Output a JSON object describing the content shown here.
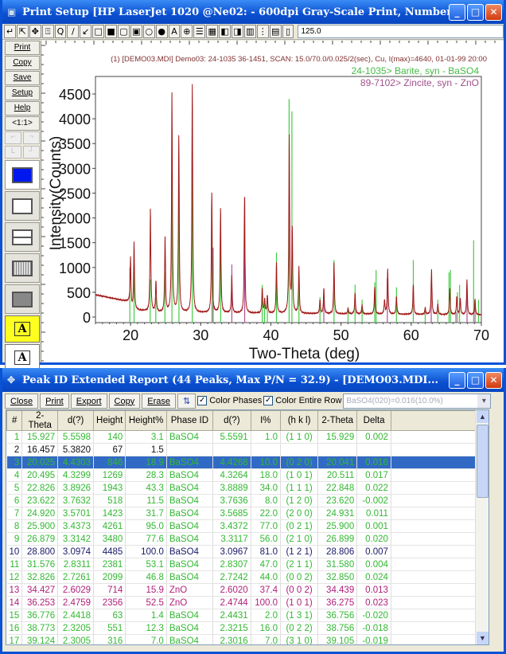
{
  "print_window": {
    "title": "Print Setup [HP LaserJet 1020 @Ne02: - 600dpi Gray-Scale Print, Number of Har...",
    "toolbar_icons": [
      "return-icon",
      "pointer-icon",
      "move-icon",
      "text-cursor-icon",
      "magnifier-icon",
      "line-icon",
      "arrow-line-icon",
      "rectangle-icon",
      "filled-rectangle-icon",
      "rounded-rect-icon",
      "filled-rounded-rect-icon",
      "ellipse-icon",
      "filled-ellipse-icon",
      "text-A-icon",
      "circled-number-icon",
      "list-icon",
      "grid-icon",
      "bw-icon",
      "gray-icon",
      "color-icon",
      "dots-icon",
      "layout-icon",
      "trash-icon"
    ],
    "toolbar_glyphs": [
      "↵",
      "⇱",
      "✥",
      "⍐",
      "Q",
      "/",
      "↙",
      "□",
      "■",
      "▢",
      "▣",
      "○",
      "●",
      "A",
      "⊕",
      "☰",
      "▦",
      "◧",
      "◨",
      "▥",
      "⋮",
      "▤",
      "▯"
    ],
    "zoom_value": "125.0",
    "sidebar": {
      "buttons": [
        "Print",
        "Copy",
        "Save",
        "Setup",
        "Help"
      ],
      "ratio": "<1:1>"
    },
    "header_line": "(1) [DEMO03.MDI] Demo03: 24-1035 36-1451, SCAN: 15.0/70.0/0.025/2(sec), Cu, I(max)=4640, 01-01-99 20:00"
  },
  "chart_data": {
    "type": "line",
    "xlabel": "Two-Theta (deg)",
    "ylabel": "Intensity(Counts)",
    "xlim": [
      15,
      70
    ],
    "ylim": [
      0,
      4800
    ],
    "xticks": [
      20,
      30,
      40,
      50,
      60,
      70
    ],
    "yticks": [
      0,
      500,
      1000,
      1500,
      2000,
      2500,
      3000,
      3500,
      4000,
      4500
    ],
    "grid": false,
    "legend": [
      {
        "name": "24-1035> Barite, syn - BaSO4",
        "color": "#44bb44"
      },
      {
        "name": "89-7102> Zincite, syn - ZnO",
        "color": "#a0508a"
      }
    ],
    "observed_color": "#a01818",
    "observed_peaks": [
      [
        20.0,
        1000
      ],
      [
        20.5,
        1400
      ],
      [
        22.83,
        2100
      ],
      [
        23.62,
        650
      ],
      [
        24.92,
        1550
      ],
      [
        25.9,
        4450
      ],
      [
        26.88,
        3600
      ],
      [
        28.8,
        4640
      ],
      [
        31.58,
        2450
      ],
      [
        32.83,
        2150
      ],
      [
        34.43,
        780
      ],
      [
        36.25,
        2370
      ],
      [
        38.77,
        520
      ],
      [
        39.12,
        300
      ],
      [
        39.5,
        380
      ],
      [
        40.8,
        1050
      ],
      [
        42.62,
        3600
      ],
      [
        43.05,
        1700
      ],
      [
        44.0,
        950
      ],
      [
        47.0,
        300
      ],
      [
        47.55,
        520
      ],
      [
        49.0,
        1050
      ],
      [
        51.0,
        130
      ],
      [
        52.0,
        450
      ],
      [
        53.0,
        200
      ],
      [
        54.8,
        560
      ],
      [
        56.2,
        300
      ],
      [
        56.65,
        930
      ],
      [
        57.9,
        380
      ],
      [
        60.3,
        620
      ],
      [
        62.0,
        150
      ],
      [
        62.9,
        920
      ],
      [
        63.8,
        230
      ],
      [
        65.5,
        530
      ],
      [
        66.5,
        380
      ],
      [
        67.0,
        330
      ],
      [
        67.95,
        720
      ],
      [
        69.1,
        330
      ]
    ],
    "baso4_sticks": [
      [
        19.9,
        1000
      ],
      [
        20.5,
        1350
      ],
      [
        22.8,
        760
      ],
      [
        23.6,
        400
      ],
      [
        24.9,
        900
      ],
      [
        25.9,
        3800
      ],
      [
        26.9,
        2500
      ],
      [
        28.8,
        3300
      ],
      [
        31.6,
        1800
      ],
      [
        32.85,
        1700
      ],
      [
        38.77,
        650
      ],
      [
        39.1,
        300
      ],
      [
        39.5,
        400
      ],
      [
        40.8,
        1300
      ],
      [
        42.6,
        4400
      ],
      [
        43.0,
        4150
      ],
      [
        44.0,
        850
      ],
      [
        47.0,
        400
      ],
      [
        49.0,
        1150
      ],
      [
        51.0,
        200
      ],
      [
        52.0,
        650
      ],
      [
        53.0,
        350
      ],
      [
        54.8,
        700
      ],
      [
        55.0,
        950
      ],
      [
        57.9,
        600
      ],
      [
        60.3,
        1150
      ],
      [
        62.0,
        200
      ],
      [
        63.8,
        350
      ],
      [
        65.4,
        900
      ],
      [
        65.6,
        950
      ],
      [
        66.6,
        500
      ],
      [
        66.9,
        650
      ],
      [
        68.9,
        1550
      ],
      [
        69.6,
        350
      ]
    ],
    "zno_sticks": [
      [
        31.77,
        1400
      ],
      [
        34.44,
        1060
      ],
      [
        36.27,
        2420
      ],
      [
        47.55,
        560
      ],
      [
        56.6,
        780
      ],
      [
        62.86,
        700
      ],
      [
        66.38,
        100
      ],
      [
        67.96,
        560
      ],
      [
        69.1,
        270
      ]
    ]
  },
  "report_window": {
    "title": "Peak ID Extended Report (44 Peaks, Max P/N = 32.9) - [DEMO03.MDI...",
    "buttons": [
      "Close",
      "Print",
      "Export",
      "Copy",
      "Erase"
    ],
    "color_phases_label": "Color Phases",
    "color_phases_checked": true,
    "color_row_label": "Color Entire Row",
    "color_row_checked": true,
    "combo_value": "BaSO4(020)=0.016(10.0%)",
    "columns": [
      "#",
      "2-Theta",
      "d(?)",
      "Height",
      "Height%",
      "Phase ID",
      "d(?)",
      "I%",
      "(h k l)",
      "2-Theta",
      "Delta"
    ],
    "phase_colors": {
      "BaSO4": "#33b833",
      "ZnO": "#b0207a",
      "none": "#111111",
      "strong": "#1a1a6a"
    },
    "selected_row": 3,
    "rows": [
      [
        "1",
        "15.927",
        "5.5598",
        "140",
        "3.1",
        "BaSO4",
        "5.5591",
        "1.0",
        "(1 1 0)",
        "15.929",
        "0.002"
      ],
      [
        "2",
        "16.457",
        "5.3820",
        "67",
        "1.5",
        "",
        "",
        "",
        "",
        "",
        ""
      ],
      [
        "3",
        "20.025",
        "4.4303",
        "846",
        "18.9",
        "BaSO4",
        "4.4268",
        "10.0",
        "(0 2 0)",
        "20.041",
        "0.016"
      ],
      [
        "4",
        "20.495",
        "4.3299",
        "1269",
        "28.3",
        "BaSO4",
        "4.3264",
        "18.0",
        "(1 0 1)",
        "20.511",
        "0.017"
      ],
      [
        "5",
        "22.826",
        "3.8926",
        "1943",
        "43.3",
        "BaSO4",
        "3.8889",
        "34.0",
        "(1 1 1)",
        "22.848",
        "0.022"
      ],
      [
        "6",
        "23.622",
        "3.7632",
        "518",
        "11.5",
        "BaSO4",
        "3.7636",
        "8.0",
        "(1 2 0)",
        "23.620",
        "-0.002"
      ],
      [
        "7",
        "24.920",
        "3.5701",
        "1423",
        "31.7",
        "BaSO4",
        "3.5685",
        "22.0",
        "(2 0 0)",
        "24.931",
        "0.011"
      ],
      [
        "8",
        "25.900",
        "3.4373",
        "4261",
        "95.0",
        "BaSO4",
        "3.4372",
        "77.0",
        "(0 2 1)",
        "25.900",
        "0.001"
      ],
      [
        "9",
        "26.879",
        "3.3142",
        "3480",
        "77.6",
        "BaSO4",
        "3.3117",
        "56.0",
        "(2 1 0)",
        "26.899",
        "0.020"
      ],
      [
        "10",
        "28.800",
        "3.0974",
        "4485",
        "100.0",
        "BaSO4",
        "3.0967",
        "81.0",
        "(1 2 1)",
        "28.806",
        "0.007"
      ],
      [
        "11",
        "31.576",
        "2.8311",
        "2381",
        "53.1",
        "BaSO4",
        "2.8307",
        "47.0",
        "(2 1 1)",
        "31.580",
        "0.004"
      ],
      [
        "12",
        "32.826",
        "2.7261",
        "2099",
        "46.8",
        "BaSO4",
        "2.7242",
        "44.0",
        "(0 0 2)",
        "32.850",
        "0.024"
      ],
      [
        "13",
        "34.427",
        "2.6029",
        "714",
        "15.9",
        "ZnO",
        "2.6020",
        "37.4",
        "(0 0 2)",
        "34.439",
        "0.013"
      ],
      [
        "14",
        "36.253",
        "2.4759",
        "2356",
        "52.5",
        "ZnO",
        "2.4744",
        "100.0",
        "(1 0 1)",
        "36.275",
        "0.023"
      ],
      [
        "15",
        "36.776",
        "2.4418",
        "63",
        "1.4",
        "BaSO4",
        "2.4431",
        "2.0",
        "(1 3 1)",
        "36.756",
        "-0.020"
      ],
      [
        "16",
        "38.773",
        "2.3205",
        "551",
        "12.3",
        "BaSO4",
        "2.3215",
        "16.0",
        "(0 2 2)",
        "38.756",
        "-0.018"
      ],
      [
        "17",
        "39.124",
        "2.3005",
        "316",
        "7.0",
        "BaSO4",
        "2.3016",
        "7.0",
        "(3 1 0)",
        "39.105",
        "-0.019"
      ]
    ]
  }
}
